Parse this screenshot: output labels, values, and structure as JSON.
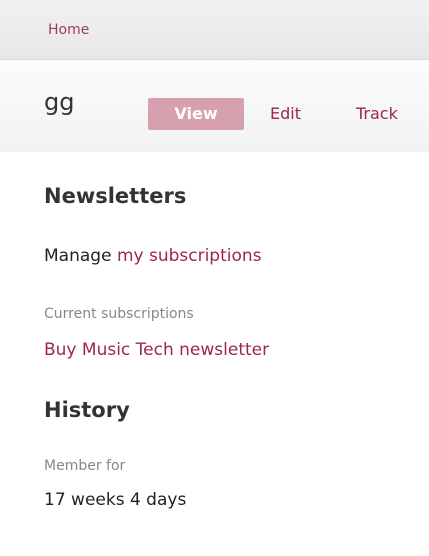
{
  "breadcrumb": {
    "home": "Home"
  },
  "header": {
    "title": "gg",
    "tabs": {
      "view": "View",
      "edit": "Edit",
      "track": "Track"
    }
  },
  "newsletters": {
    "heading": "Newsletters",
    "manage_prefix": "Manage",
    "manage_link": "my subscriptions",
    "current_label": "Current subscriptions",
    "current_value": "Buy Music Tech newsletter"
  },
  "history": {
    "heading": "History",
    "member_label": "Member for",
    "member_value": "17 weeks 4 days"
  },
  "colors": {
    "accent": "#9c2748",
    "active_tab": "#d7a0ae"
  }
}
